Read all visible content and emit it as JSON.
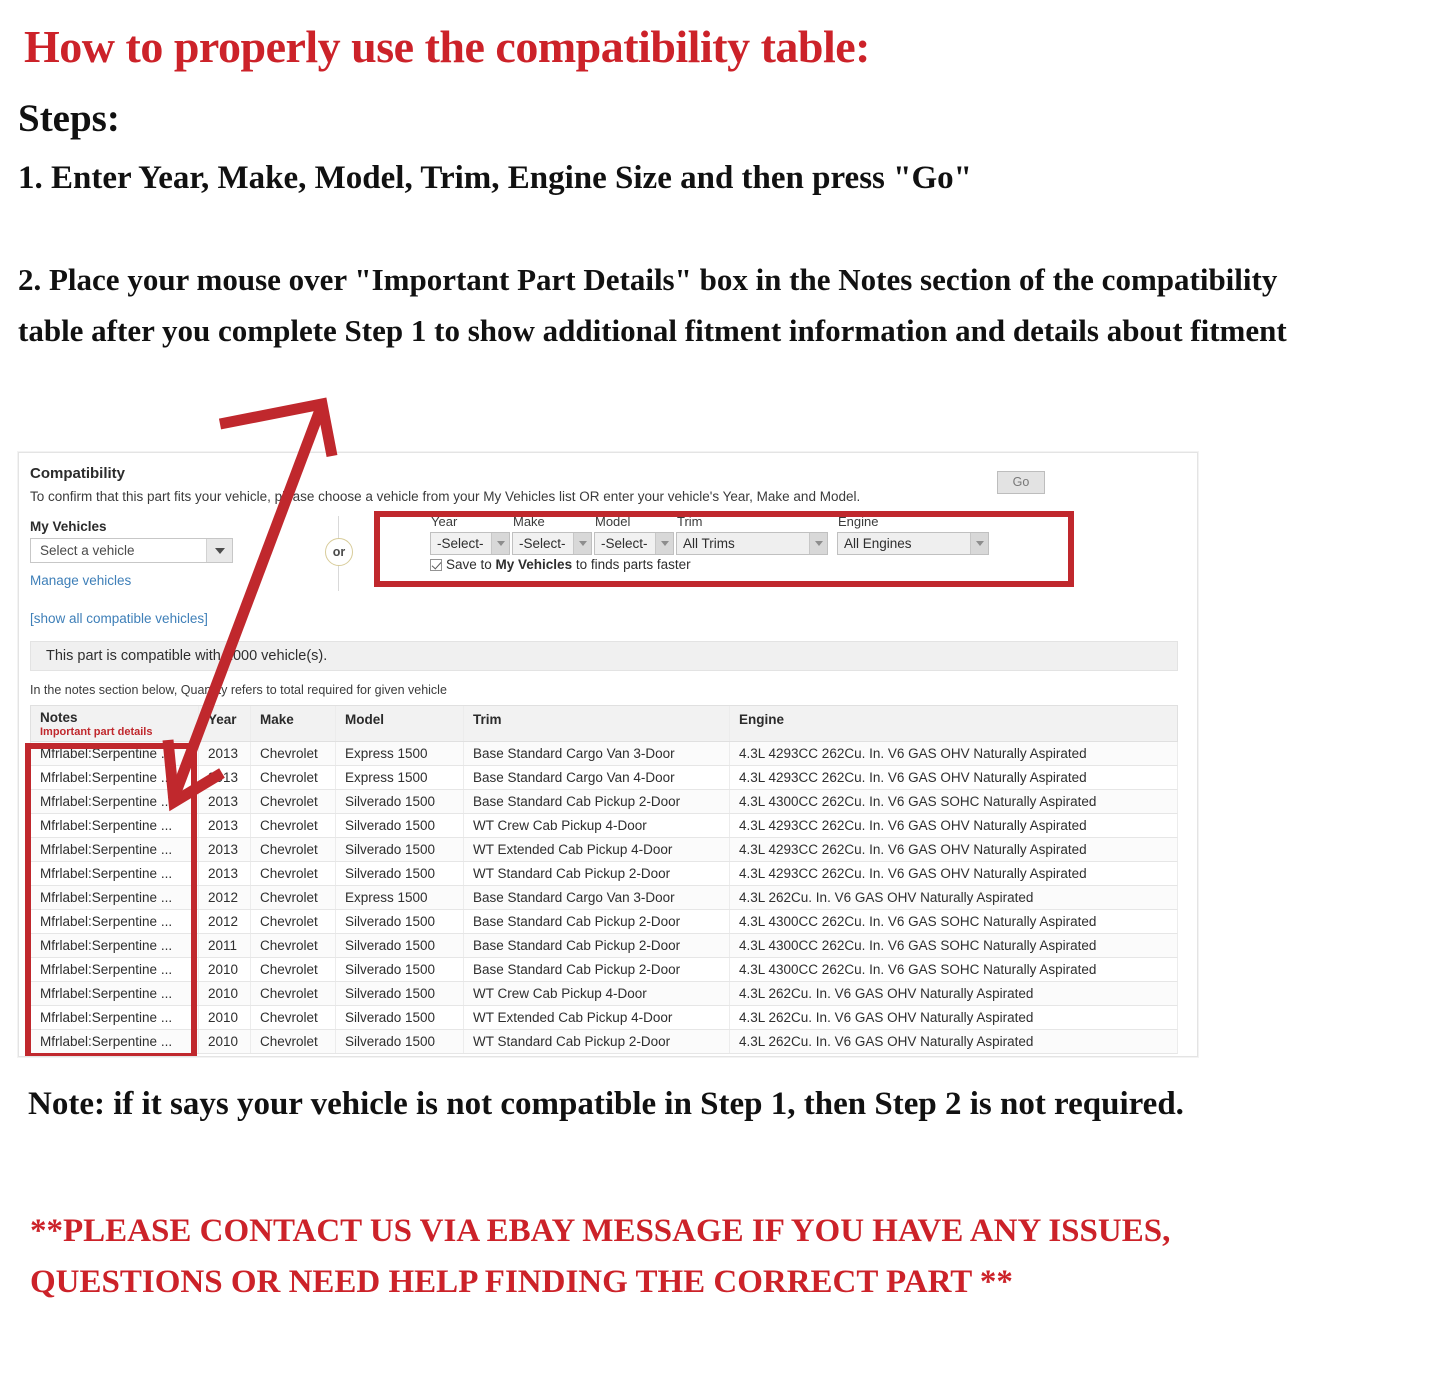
{
  "colors": {
    "red_heading": "#cc2229",
    "red_highlight_box": "#c0282d",
    "link_blue": "#3e7fb8",
    "table_header_bg": "#f2f2f2"
  },
  "headings": {
    "main_title": "How to properly use the compatibility table:",
    "steps_label": "Steps:",
    "step_1": "1. Enter Year, Make, Model, Trim, Engine Size and then press \"Go\"",
    "step_2": "2. Place your mouse over \"Important Part Details\" box in the Notes section of the compatibility table after you complete Step 1 to show additional fitment information and details about fitment"
  },
  "panel": {
    "title": "Compatibility",
    "subtitle": "To confirm that this part fits your vehicle, please choose a vehicle from your My Vehicles list OR enter your vehicle's Year, Make and Model.",
    "my_vehicles_label": "My Vehicles",
    "vehicle_select_value": "Select a vehicle",
    "manage_vehicles_link": "Manage vehicles",
    "show_all_link": "[show all compatible vehicles]",
    "or_label": "or",
    "compat_banner": "This part is compatible with 1000 vehicle(s).",
    "notes_hint": "In the notes section below, Quantity refers to total required for given vehicle"
  },
  "form": {
    "year": {
      "label": "Year",
      "value": "-Select-"
    },
    "make": {
      "label": "Make",
      "value": "-Select-"
    },
    "model": {
      "label": "Model",
      "value": "-Select-"
    },
    "trim": {
      "label": "Trim",
      "value": "All Trims"
    },
    "engine": {
      "label": "Engine",
      "value": "All Engines"
    },
    "go_label": "Go",
    "save_checkbox": {
      "checked": true,
      "text_before": "Save to ",
      "text_bold": "My Vehicles",
      "text_after": " to finds parts faster"
    }
  },
  "table": {
    "headers": {
      "notes": "Notes",
      "notes_sub": "Important part details",
      "year": "Year",
      "make": "Make",
      "model": "Model",
      "trim": "Trim",
      "engine": "Engine"
    },
    "rows": [
      {
        "notes": "Mfrlabel:Serpentine ...",
        "year": "2013",
        "make": "Chevrolet",
        "model": "Express 1500",
        "trim": "Base Standard Cargo Van 3-Door",
        "engine": "4.3L 4293CC 262Cu. In. V6 GAS OHV Naturally Aspirated"
      },
      {
        "notes": "Mfrlabel:Serpentine ...",
        "year": "2013",
        "make": "Chevrolet",
        "model": "Express 1500",
        "trim": "Base Standard Cargo Van 4-Door",
        "engine": "4.3L 4293CC 262Cu. In. V6 GAS OHV Naturally Aspirated"
      },
      {
        "notes": "Mfrlabel:Serpentine ...",
        "year": "2013",
        "make": "Chevrolet",
        "model": "Silverado 1500",
        "trim": "Base Standard Cab Pickup 2-Door",
        "engine": "4.3L 4300CC 262Cu. In. V6 GAS SOHC Naturally Aspirated"
      },
      {
        "notes": "Mfrlabel:Serpentine ...",
        "year": "2013",
        "make": "Chevrolet",
        "model": "Silverado 1500",
        "trim": "WT Crew Cab Pickup 4-Door",
        "engine": "4.3L 4293CC 262Cu. In. V6 GAS OHV Naturally Aspirated"
      },
      {
        "notes": "Mfrlabel:Serpentine ...",
        "year": "2013",
        "make": "Chevrolet",
        "model": "Silverado 1500",
        "trim": "WT Extended Cab Pickup 4-Door",
        "engine": "4.3L 4293CC 262Cu. In. V6 GAS OHV Naturally Aspirated"
      },
      {
        "notes": "Mfrlabel:Serpentine ...",
        "year": "2013",
        "make": "Chevrolet",
        "model": "Silverado 1500",
        "trim": "WT Standard Cab Pickup 2-Door",
        "engine": "4.3L 4293CC 262Cu. In. V6 GAS OHV Naturally Aspirated"
      },
      {
        "notes": "Mfrlabel:Serpentine ...",
        "year": "2012",
        "make": "Chevrolet",
        "model": "Express 1500",
        "trim": "Base Standard Cargo Van 3-Door",
        "engine": "4.3L 262Cu. In. V6 GAS OHV Naturally Aspirated"
      },
      {
        "notes": "Mfrlabel:Serpentine ...",
        "year": "2012",
        "make": "Chevrolet",
        "model": "Silverado 1500",
        "trim": "Base Standard Cab Pickup 2-Door",
        "engine": "4.3L 4300CC 262Cu. In. V6 GAS SOHC Naturally Aspirated"
      },
      {
        "notes": "Mfrlabel:Serpentine ...",
        "year": "2011",
        "make": "Chevrolet",
        "model": "Silverado 1500",
        "trim": "Base Standard Cab Pickup 2-Door",
        "engine": "4.3L 4300CC 262Cu. In. V6 GAS SOHC Naturally Aspirated"
      },
      {
        "notes": "Mfrlabel:Serpentine ...",
        "year": "2010",
        "make": "Chevrolet",
        "model": "Silverado 1500",
        "trim": "Base Standard Cab Pickup 2-Door",
        "engine": "4.3L 4300CC 262Cu. In. V6 GAS SOHC Naturally Aspirated"
      },
      {
        "notes": "Mfrlabel:Serpentine ...",
        "year": "2010",
        "make": "Chevrolet",
        "model": "Silverado 1500",
        "trim": "WT Crew Cab Pickup 4-Door",
        "engine": "4.3L 262Cu. In. V6 GAS OHV Naturally Aspirated"
      },
      {
        "notes": "Mfrlabel:Serpentine ...",
        "year": "2010",
        "make": "Chevrolet",
        "model": "Silverado 1500",
        "trim": "WT Extended Cab Pickup 4-Door",
        "engine": "4.3L 262Cu. In. V6 GAS OHV Naturally Aspirated"
      },
      {
        "notes": "Mfrlabel:Serpentine ...",
        "year": "2010",
        "make": "Chevrolet",
        "model": "Silverado 1500",
        "trim": "WT Standard Cab Pickup 2-Door",
        "engine": "4.3L 262Cu. In. V6 GAS OHV Naturally Aspirated"
      }
    ]
  },
  "footer": {
    "note": "Note: if it says your vehicle is not compatible in Step 1, then Step 2 is not required.",
    "contact": "**PLEASE CONTACT US VIA EBAY MESSAGE IF YOU HAVE ANY ISSUES, QUESTIONS OR NEED HELP FINDING THE CORRECT PART **"
  }
}
